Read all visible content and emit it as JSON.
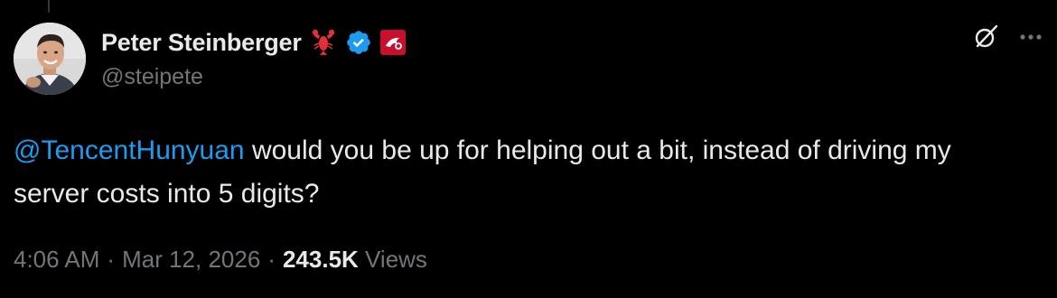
{
  "tweet": {
    "author": {
      "display_name": "Peter Steinberger",
      "handle": "@steipete",
      "badges": [
        "lobster-emoji",
        "verified-check",
        "affiliate-badge"
      ],
      "verified_color": "#1d9bf0"
    },
    "actions": {
      "grok_icon": "grok-icon",
      "more_icon": "more-icon"
    },
    "text": {
      "mention": "@TencentHunyuan",
      "body": " would you be up for helping out a bit, instead of driving my server costs into 5 digits?"
    },
    "meta": {
      "time": "4:06 AM",
      "separator": "·",
      "date": "Mar 12, 2026",
      "views_count": "243.5K",
      "views_label": "Views"
    }
  },
  "colors": {
    "background": "#000000",
    "text_primary": "#e7e9ea",
    "text_secondary": "#71767b",
    "link": "#1d9bf0"
  }
}
